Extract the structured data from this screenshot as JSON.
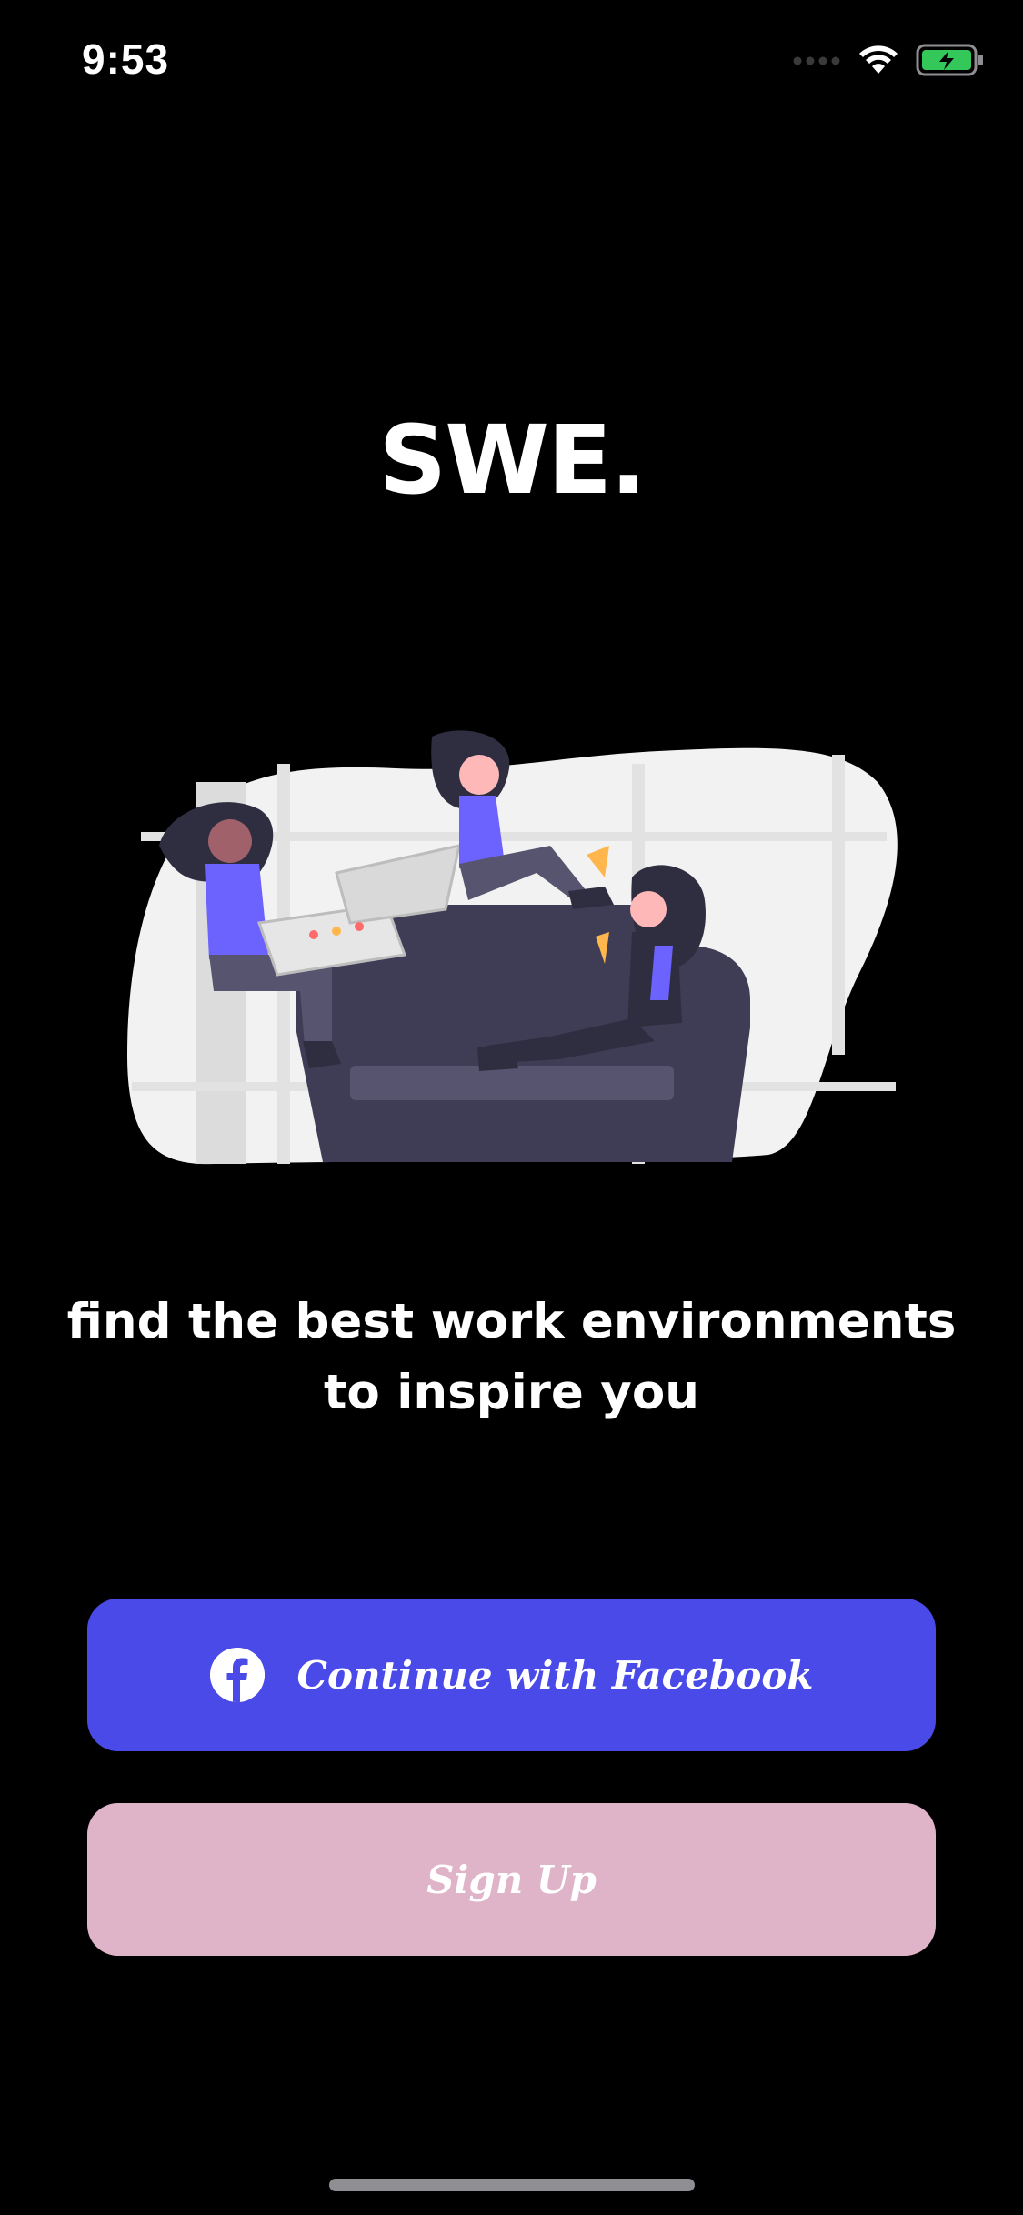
{
  "status_bar": {
    "time": "9:53",
    "icons": [
      "signal-icon",
      "wifi-icon",
      "battery-charging-icon"
    ]
  },
  "app": {
    "title": "SWE.",
    "tagline": "find the best work environments to inspire you"
  },
  "hero_illustration": {
    "name": "friends-on-couch-eating-pizza-illustration"
  },
  "buttons": {
    "facebook_label": "Continue with Facebook",
    "signup_label": "Sign Up"
  },
  "colors": {
    "background": "#000000",
    "facebook_button": "#4a4ae8",
    "signup_button": "#dfb4c8",
    "text": "#ffffff",
    "accent_purple": "#6c63ff"
  }
}
